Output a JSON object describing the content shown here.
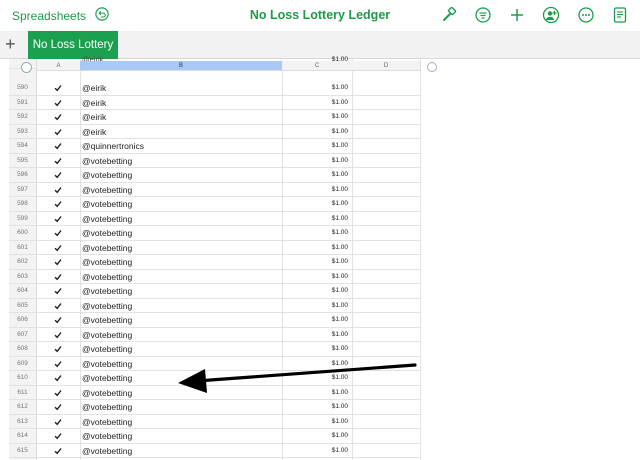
{
  "topbar": {
    "back_label": "Spreadsheets",
    "title": "No Loss Lottery Ledger",
    "icons": [
      "undo-icon",
      "format-brush-icon",
      "filter-icon",
      "add-icon",
      "collaborate-icon",
      "more-icon",
      "document-icon"
    ]
  },
  "tabs": {
    "add_label": "+",
    "active": "No Loss Lottery"
  },
  "columns": [
    "A",
    "B",
    "C",
    "D"
  ],
  "partial_row": {
    "name": "@eirik",
    "amount": "$1.00"
  },
  "rows": [
    {
      "num": "590",
      "name": "@eirik",
      "amount": "$1.00"
    },
    {
      "num": "591",
      "name": "@eirik",
      "amount": "$1.00"
    },
    {
      "num": "592",
      "name": "@eirik",
      "amount": "$1.00"
    },
    {
      "num": "593",
      "name": "@eirik",
      "amount": "$1.00"
    },
    {
      "num": "594",
      "name": "@quinnertronics",
      "amount": "$1.00"
    },
    {
      "num": "595",
      "name": "@votebetting",
      "amount": "$1.00"
    },
    {
      "num": "596",
      "name": "@votebetting",
      "amount": "$1.00"
    },
    {
      "num": "597",
      "name": "@votebetting",
      "amount": "$1.00"
    },
    {
      "num": "598",
      "name": "@votebetting",
      "amount": "$1.00"
    },
    {
      "num": "599",
      "name": "@votebetting",
      "amount": "$1.00"
    },
    {
      "num": "600",
      "name": "@votebetting",
      "amount": "$1.00"
    },
    {
      "num": "601",
      "name": "@votebetting",
      "amount": "$1.00"
    },
    {
      "num": "602",
      "name": "@votebetting",
      "amount": "$1.00"
    },
    {
      "num": "603",
      "name": "@votebetting",
      "amount": "$1.00"
    },
    {
      "num": "604",
      "name": "@votebetting",
      "amount": "$1.00"
    },
    {
      "num": "605",
      "name": "@votebetting",
      "amount": "$1.00"
    },
    {
      "num": "606",
      "name": "@votebetting",
      "amount": "$1.00"
    },
    {
      "num": "607",
      "name": "@votebetting",
      "amount": "$1.00"
    },
    {
      "num": "608",
      "name": "@votebetting",
      "amount": "$1.00"
    },
    {
      "num": "609",
      "name": "@votebetting",
      "amount": "$1.00"
    },
    {
      "num": "610",
      "name": "@votebetting",
      "amount": "$1.00"
    },
    {
      "num": "611",
      "name": "@votebetting",
      "amount": "$1.00"
    },
    {
      "num": "612",
      "name": "@votebetting",
      "amount": "$1.00"
    },
    {
      "num": "613",
      "name": "@votebetting",
      "amount": "$1.00"
    },
    {
      "num": "614",
      "name": "@votebetting",
      "amount": "$1.00"
    },
    {
      "num": "615",
      "name": "@votebetting",
      "amount": "$1.00"
    }
  ],
  "colors": {
    "accent": "#1aa04f",
    "selected_column": "#a9c8f5",
    "annotation_arrow": "#000000"
  }
}
